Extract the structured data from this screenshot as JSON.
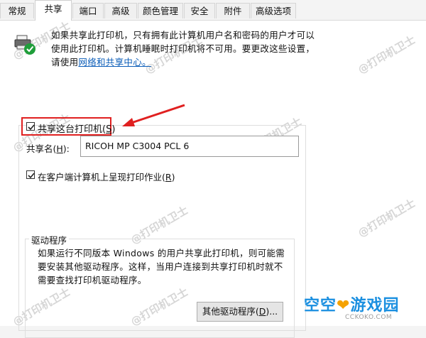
{
  "tabs": [
    {
      "label": "常规"
    },
    {
      "label": "共享"
    },
    {
      "label": "端口"
    },
    {
      "label": "高级"
    },
    {
      "label": "颜色管理"
    },
    {
      "label": "安全"
    },
    {
      "label": "附件"
    },
    {
      "label": "高级选项"
    }
  ],
  "active_tab": "共享",
  "info": {
    "text": "如果共享此打印机，只有拥有此计算机用户名和密码的用户才可以使用此打印机。计算机睡眠时打印机将不可用。要更改这些设置，请使用",
    "link_text": "网络和共享中心。"
  },
  "share": {
    "checkbox_label": "共享这台打印机(S)",
    "checkbox_label_main": "共享这台打印机(",
    "checkbox_label_key": "S",
    "checked": true,
    "name_label_main": "共享名(",
    "name_label_key": "H",
    "name_label_end": "):",
    "name_value": "RICOH MP C3004 PCL 6",
    "render_label_main": "在客户端计算机上呈现打印作业(",
    "render_label_key": "R",
    "render_checked": true
  },
  "drivers": {
    "title": "驱动程序",
    "text": "如果运行不同版本 Windows 的用户共享此打印机，则可能需要安装其他驱动程序。这样，当用户连接到共享打印机时就不需要查找打印机驱动程序。",
    "button_main": "其他驱动程序(",
    "button_key": "D",
    "button_end": ")..."
  },
  "watermark": {
    "text": "@打印机卫士"
  },
  "brand": {
    "part1": "空空",
    "part2": "游戏园",
    "url": "CCKOKO.COM"
  },
  "colors": {
    "highlight": "#e02020",
    "link": "#0a5cb8",
    "brand_blue": "#1a8fe0",
    "brand_orange": "#f5a200"
  }
}
